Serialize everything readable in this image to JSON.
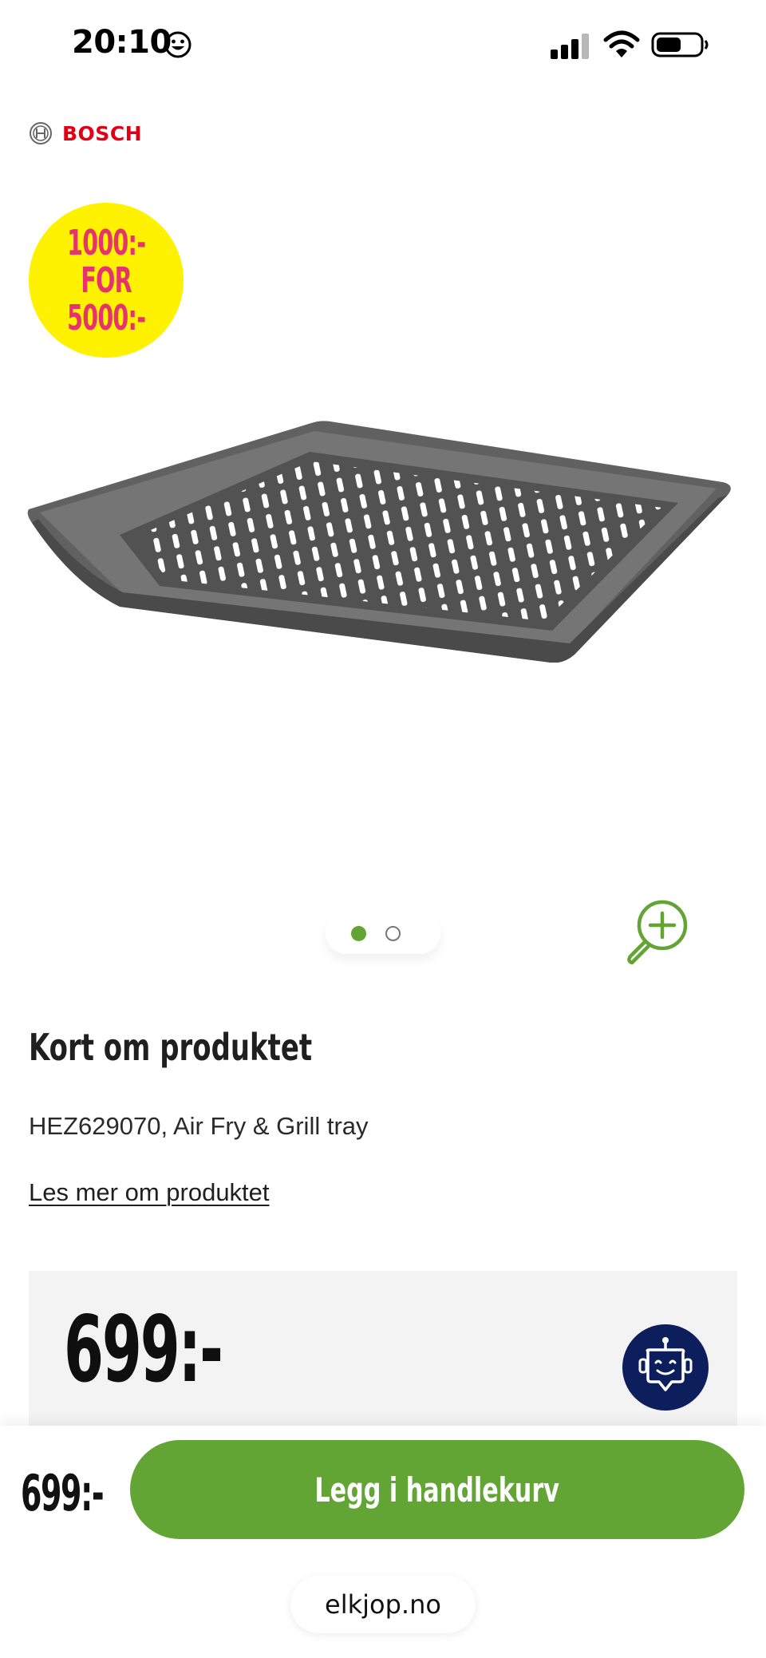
{
  "status_bar": {
    "time": "20:10"
  },
  "brand": {
    "name": "BOSCH",
    "color": "#e20015"
  },
  "promo": {
    "line1": "1000:-",
    "line2": "FOR",
    "line3": "5000:-",
    "bg_color": "#fff200",
    "text_color": "#e6336d"
  },
  "carousel": {
    "total": 2,
    "active": 1
  },
  "section": {
    "title": "Kort om produktet",
    "description": "HEZ629070, Air Fry & Grill tray",
    "read_more": "Les mer om produktet"
  },
  "price": {
    "main": "699:-"
  },
  "bottom_bar": {
    "price": "699:-",
    "add_to_cart": "Legg i handlekurv",
    "url": "elkjop.no"
  },
  "colors": {
    "accent_green": "#62a535",
    "chat_navy": "#0c1e5b"
  }
}
